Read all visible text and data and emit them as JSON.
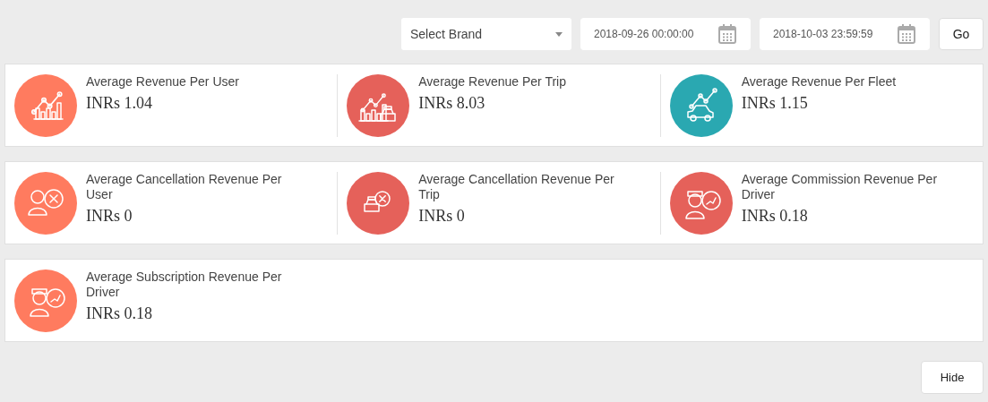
{
  "filters": {
    "brand": {
      "placeholder": "Select Brand"
    },
    "start_date": {
      "value": "2018-09-26 00:00:00"
    },
    "end_date": {
      "value": "2018-10-03 23:59:59"
    },
    "go_button": "Go"
  },
  "panels": [
    {
      "stats": [
        {
          "title": "Average Revenue Per User",
          "value": "INRs 1.04",
          "color": "#ff7b5f",
          "kind": "chart"
        },
        {
          "title": "Average Revenue Per Trip",
          "value": "INRs 8.03",
          "color": "#e5615a",
          "kind": "chart-taxi"
        },
        {
          "title": "Average Revenue Per Fleet",
          "value": "INRs 1.15",
          "color": "#2aa8b1",
          "kind": "chart-car"
        }
      ]
    },
    {
      "stats": [
        {
          "title": "Average Cancellation Revenue Per User",
          "value": "INRs 0",
          "color": "#ff7b5f",
          "kind": "user-cancel"
        },
        {
          "title": "Average Cancellation Revenue Per Trip",
          "value": "INRs 0",
          "color": "#e5615a",
          "kind": "taxi-cancel"
        },
        {
          "title": "Average Commission Revenue Per Driver",
          "value": "INRs 0.18",
          "color": "#e5615a",
          "kind": "driver"
        }
      ]
    },
    {
      "stats": [
        {
          "title": "Average Subscription Revenue Per Driver",
          "value": "INRs 0.18",
          "color": "#ff7b5f",
          "kind": "driver"
        }
      ]
    }
  ],
  "hide_button": "Hide"
}
